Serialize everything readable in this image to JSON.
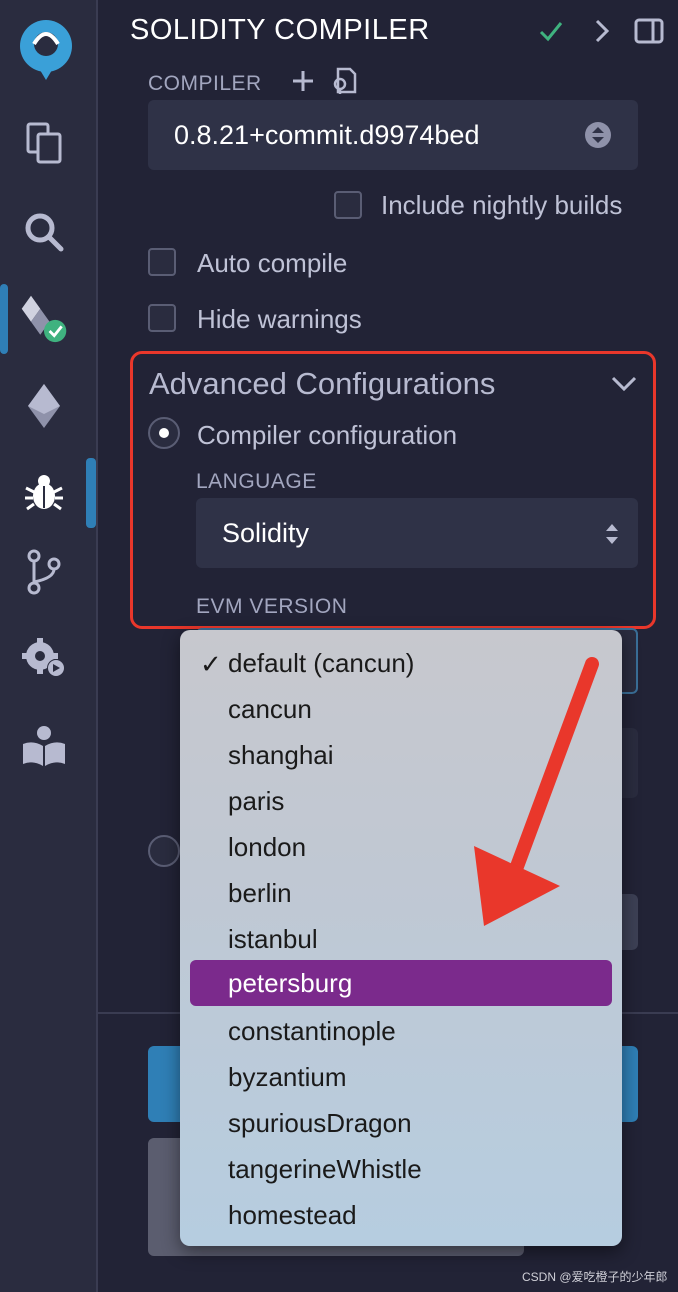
{
  "panel": {
    "title": "SOLIDITY COMPILER",
    "compiler_label": "COMPILER",
    "compiler_version": "0.8.21+commit.d9974bed",
    "include_nightly_label": "Include nightly builds",
    "auto_compile_label": "Auto compile",
    "hide_warnings_label": "Hide warnings"
  },
  "advanced": {
    "title": "Advanced Configurations",
    "compiler_config_label": "Compiler configuration",
    "language_label": "LANGUAGE",
    "language_value": "Solidity",
    "evm_version_label": "EVM VERSION"
  },
  "evm_dropdown": {
    "options": [
      "default (cancun)",
      "cancun",
      "shanghai",
      "paris",
      "london",
      "berlin",
      "istanbul",
      "petersburg",
      "constantinople",
      "byzantium",
      "spuriousDragon",
      "tangerineWhistle",
      "homestead"
    ],
    "checked": "default (cancun)",
    "highlighted": "petersburg"
  },
  "colors": {
    "accent_blue": "#2f7fb6",
    "success_green": "#3fb27f",
    "highlight_purple": "#7b2a8c",
    "annotation_red": "#e9372b"
  },
  "rail_icons": [
    "logo-icon",
    "file-explorer-icon",
    "search-icon",
    "solidity-compiler-icon",
    "deploy-icon",
    "debugger-icon",
    "git-icon",
    "settings-icon",
    "learn-icon"
  ],
  "watermark": "CSDN @爱吃橙子的少年郎"
}
